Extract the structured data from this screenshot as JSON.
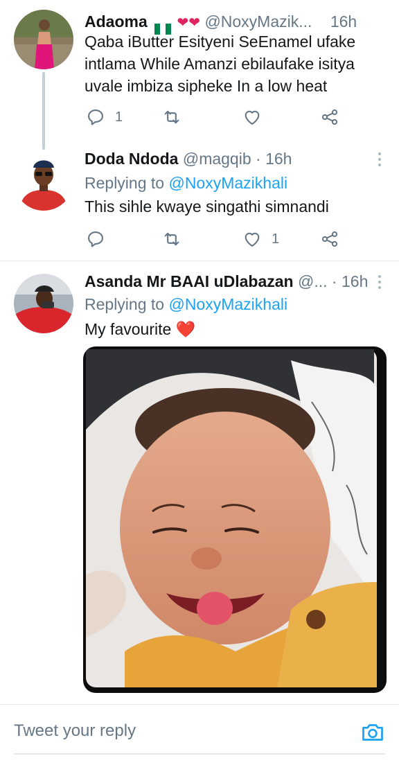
{
  "tweets": [
    {
      "name": "Adaoma",
      "handle": "@NoxyMazik...",
      "time": "16h",
      "body": "Qaba iButter Esityeni SeEnamel ufake intlama While Amanzi ebilaufake isitya uvale imbiza sipheke In a low heat",
      "reply_count": "1",
      "retweet_count": "",
      "like_count": ""
    },
    {
      "name": "Doda Ndoda",
      "handle": "@magqib",
      "separator": "·",
      "time": "16h",
      "replying_label": "Replying to",
      "replying_to": "@NoxyMazikhali",
      "body": "This sihle kwaye singathi simnandi",
      "reply_count": "",
      "retweet_count": "",
      "like_count": "1"
    },
    {
      "name": "Asanda Mr BAAI uDlabazan",
      "handle": "@...",
      "separator": "·",
      "time": "16h",
      "replying_label": "Replying to",
      "replying_to": "@NoxyMazikhali",
      "body": "My favourite",
      "emoji": "❤️"
    }
  ],
  "reply_bar": {
    "placeholder": "Tweet your reply"
  },
  "icons": {
    "reply": "reply-icon",
    "retweet": "retweet-icon",
    "like": "heart-icon",
    "share": "share-icon",
    "more": "more-vertical-icon",
    "camera": "camera-icon"
  },
  "colors": {
    "link": "#1da1f2",
    "muted": "#657786",
    "text": "#14171a",
    "heart_emoji": "#e0245e"
  }
}
